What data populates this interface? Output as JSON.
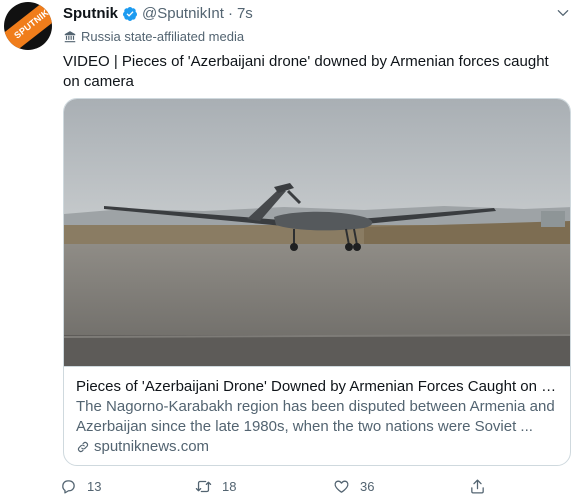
{
  "tweet": {
    "avatar_text": "SPUTNIK",
    "display_name": "Sputnik",
    "handle": "@SputnikInt",
    "separator": "·",
    "time": "7s",
    "label": "Russia state-affiliated media",
    "text": "VIDEO | Pieces of 'Azerbaijani drone' downed by Armenian forces caught on camera"
  },
  "card": {
    "title": "Pieces of 'Azerbaijani Drone' Downed by Armenian Forces Caught on C...",
    "description": "The Nagorno-Karabakh region has been disputed between Armenia and Azerbaijan since the late 1980s, when the two nations were Soviet ...",
    "domain": "sputniknews.com"
  },
  "actions": {
    "reply_count": "13",
    "retweet_count": "18",
    "like_count": "36"
  },
  "colors": {
    "verified": "#1d9bf0",
    "muted": "#536471",
    "text": "#0f1419",
    "brand_orange": "#f07d1b"
  },
  "icons": [
    "verified-icon",
    "caret-icon",
    "flag-icon",
    "link-icon",
    "reply-icon",
    "retweet-icon",
    "like-icon",
    "share-icon"
  ]
}
